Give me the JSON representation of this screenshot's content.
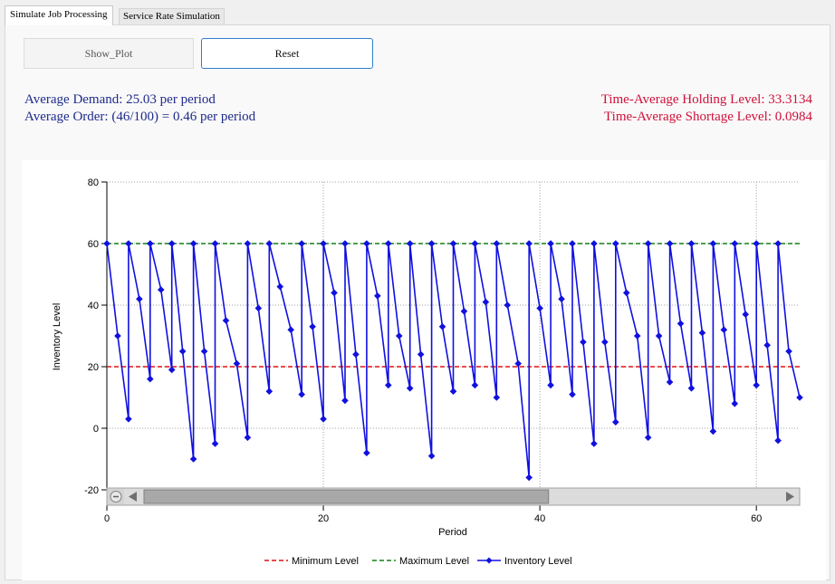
{
  "tabs": [
    {
      "label": "Simulate Job Processing",
      "active": true
    },
    {
      "label": "Service Rate Simulation",
      "active": false
    }
  ],
  "buttons": {
    "show_plot": "Show_Plot",
    "reset": "Reset"
  },
  "stats": {
    "avg_demand": "Average Demand: 25.03 per period",
    "avg_order": "Average Order: (46/100) = 0.46 per period",
    "holding": "Time-Average Holding Level: 33.3134",
    "shortage": "Time-Average Shortage Level: 0.0984"
  },
  "colors": {
    "stats_blue": "#1e2a8a",
    "stats_red": "#d0103a",
    "min_line": "#e01010",
    "max_line": "#108010",
    "inventory_line": "#1010e0"
  },
  "chart_data": {
    "type": "line",
    "xlabel": "Period",
    "ylabel": "Inventory Level",
    "xlim": [
      0,
      64
    ],
    "ylim": [
      -25,
      80
    ],
    "x_ticks": [
      0,
      20,
      40,
      60
    ],
    "y_ticks": [
      -20,
      0,
      20,
      40,
      60,
      80
    ],
    "grid": "dotted",
    "legend_position": "bottom",
    "scrollbar": true,
    "series": [
      {
        "name": "Minimum Level",
        "style": "dashed",
        "color": "#e01010",
        "constant": 20
      },
      {
        "name": "Maximum Level",
        "style": "dashed",
        "color": "#108010",
        "constant": 60
      },
      {
        "name": "Inventory Level",
        "style": "line-diamond",
        "color": "#1010e0",
        "x": [
          0,
          1,
          2,
          2,
          3,
          4,
          4,
          5,
          6,
          6,
          7,
          8,
          8,
          9,
          10,
          10,
          11,
          12,
          13,
          13,
          14,
          15,
          15,
          16,
          17,
          18,
          18,
          19,
          20,
          20,
          21,
          22,
          22,
          23,
          24,
          24,
          25,
          26,
          26,
          27,
          28,
          28,
          29,
          30,
          30,
          31,
          32,
          32,
          33,
          34,
          34,
          35,
          36,
          36,
          37,
          38,
          39,
          39,
          40,
          41,
          41,
          42,
          43,
          43,
          44,
          45,
          45,
          46,
          47,
          47,
          48,
          49,
          50,
          50,
          51,
          52,
          52,
          53,
          54,
          54,
          55,
          56,
          56,
          57,
          58,
          58,
          59,
          60,
          60,
          61,
          62,
          62,
          63,
          64
        ],
        "y": [
          60,
          30,
          3,
          60,
          42,
          16,
          60,
          45,
          19,
          60,
          25,
          -10,
          60,
          25,
          -5,
          60,
          35,
          21,
          -3,
          60,
          39,
          12,
          60,
          46,
          32,
          11,
          60,
          33,
          3,
          60,
          44,
          9,
          60,
          24,
          -8,
          60,
          43,
          14,
          60,
          30,
          13,
          60,
          24,
          -9,
          60,
          33,
          12,
          60,
          38,
          14,
          60,
          41,
          10,
          60,
          40,
          21,
          -16,
          60,
          39,
          14,
          60,
          42,
          11,
          60,
          28,
          -5,
          60,
          28,
          2,
          60,
          44,
          30,
          -3,
          60,
          30,
          15,
          60,
          34,
          13,
          60,
          31,
          -1,
          60,
          32,
          8,
          60,
          37,
          14,
          60,
          27,
          -4,
          60,
          25,
          10
        ]
      }
    ]
  }
}
